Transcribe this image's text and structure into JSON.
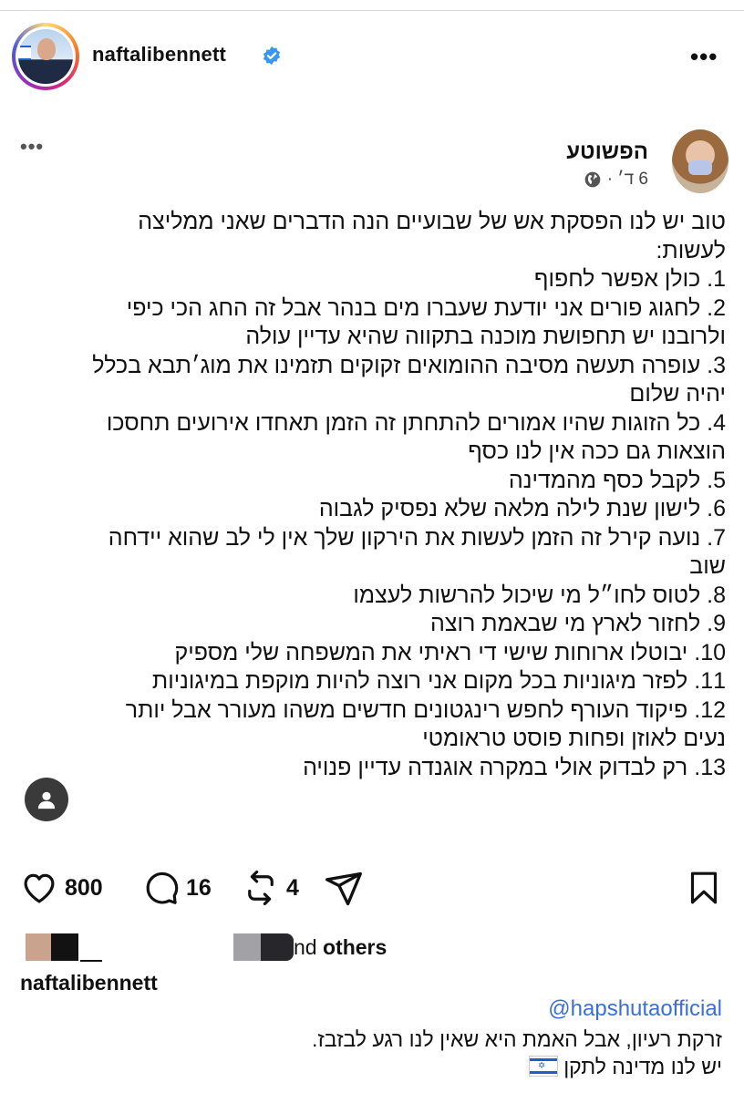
{
  "header": {
    "username": "naftalibennett",
    "verified_icon": "verified-badge-icon",
    "more_icon": "more-horizontal-icon",
    "more_glyph": "•••"
  },
  "embed": {
    "author": "הפשוטע",
    "meta": "6 ד׳ ·",
    "more_glyph": "•••",
    "lines": [
      "טוב יש לנו הפסקת אש של שבועיים הנה הדברים שאני ממליצה",
      "לעשות:",
      "1. כולן אפשר לחפוף",
      "2. לחגוג פורים אני יודעת שעברו מים בנהר אבל זה החג הכי כיפי",
      "ולרובנו יש תחפושת מוכנה בתקווה שהיא עדיין עולה",
      "3. עופרה תעשה מסיבה ההומואים זקוקים תזמינו את מוג׳תבא בכלל",
      "יהיה שלום",
      "4. כל הזוגות שהיו אמורים להתחתן זה הזמן תאחדו אירועים תחסכו",
      "הוצאות גם ככה אין לנו כסף",
      "5. לקבל כסף מהמדינה",
      "6. לישון שנת לילה מלאה שלא נפסיק לגבוה",
      "7. נועה קירל זה הזמן לעשות את הירקון שלך אין לי לב שהוא יידחה",
      "שוב",
      "8. לטוס לחו״ל מי שיכול להרשות לעצמו",
      "9. לחזור לארץ מי שבאמת רוצה",
      "10. יבוטלו ארוחות שישי די ראיתי את המשפחה שלי מספיק",
      "11. לפזר מיגוניות בכל מקום אני רוצה להיות מוקפת במיגוניות",
      "12. פיקוד העורף לחפש רינגטונים חדשים משהו מעורר אבל יותר",
      "נעים לאוזן ופחות פוסט טראומטי",
      "13. רק לבדוק אולי במקרה אוגנדה עדיין פנויה"
    ]
  },
  "actions": {
    "likes": "800",
    "comments": "16",
    "reposts": "4"
  },
  "liked_by": {
    "suffix_plain": "nd ",
    "suffix_bold": "others"
  },
  "caption": {
    "username": "naftalibennett",
    "mention": "@hapshutaofficial",
    "line1": "זרקת רעיון, אבל האמת היא שאין לנו רגע לבזבז.",
    "line2": "יש לנו מדינה לתקן"
  },
  "colors": {
    "mention": "#3a6fd8",
    "verified": "#3897f0",
    "text": "#111111"
  }
}
